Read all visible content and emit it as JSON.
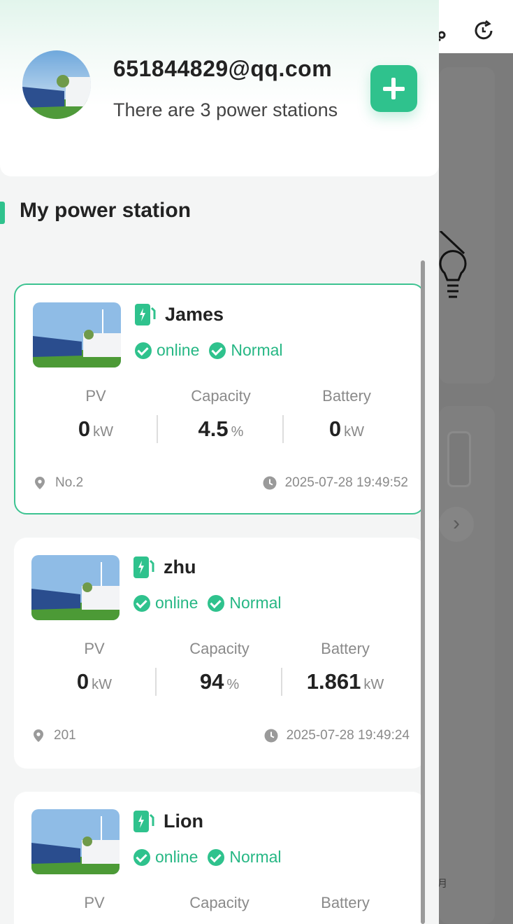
{
  "background_app": {
    "month_label": "月",
    "chevron": "›",
    "icons": [
      "headset-icon",
      "refresh-icon",
      "lightbulb-icon"
    ]
  },
  "header": {
    "email": "651844829@qq.com",
    "station_count_text": "There are 3 power stations",
    "add_icon": "plus-icon"
  },
  "section": {
    "title": "My power station"
  },
  "metric_labels": {
    "pv": "PV",
    "capacity": "Capacity",
    "battery": "Battery"
  },
  "stations": [
    {
      "name": "James",
      "online_label": "online",
      "status_label": "Normal",
      "pv_value": "0",
      "pv_unit": "kW",
      "capacity_value": "4.5",
      "capacity_unit": "%",
      "battery_value": "0",
      "battery_unit": "kW",
      "location": "No.2",
      "timestamp": "2025-07-28 19:49:52",
      "selected": true
    },
    {
      "name": "zhu",
      "online_label": "online",
      "status_label": "Normal",
      "pv_value": "0",
      "pv_unit": "kW",
      "capacity_value": "94",
      "capacity_unit": "%",
      "battery_value": "1.861",
      "battery_unit": "kW",
      "location": "201",
      "timestamp": "2025-07-28 19:49:24",
      "selected": false
    },
    {
      "name": "Lion",
      "online_label": "online",
      "status_label": "Normal",
      "selected": false
    }
  ],
  "colors": {
    "accent": "#2fc28d",
    "accent_text": "#26b784",
    "selected_border": "#3cc391"
  }
}
